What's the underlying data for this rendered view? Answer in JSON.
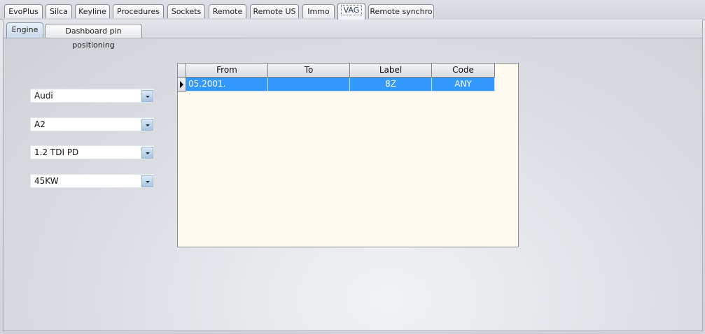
{
  "top_tabs": [
    {
      "label": "EvoPlus",
      "active": false
    },
    {
      "label": "Silca",
      "active": false
    },
    {
      "label": "Keyline",
      "active": false
    },
    {
      "label": "Procedures",
      "active": false
    },
    {
      "label": "Sockets",
      "active": false
    },
    {
      "label": "Remote",
      "active": false
    },
    {
      "label": "Remote US",
      "active": false
    },
    {
      "label": "Immo",
      "active": false
    },
    {
      "label": "VAG",
      "active": true
    },
    {
      "label": "Remote synchro",
      "active": false
    }
  ],
  "sub_tabs": [
    {
      "label": "Engine",
      "active": true
    },
    {
      "label": "Dashboard pin positioning",
      "active": false
    }
  ],
  "dropdowns": {
    "make": "Audi",
    "model": "A2",
    "engine": "1.2 TDI PD",
    "power": "45KW"
  },
  "grid": {
    "columns": [
      "From",
      "To",
      "Label",
      "Code"
    ],
    "rows": [
      {
        "from": "05.2001.",
        "to": "",
        "label": "8Z",
        "code": "ANY",
        "selected": true
      }
    ]
  },
  "colors": {
    "selection": "#3399ff",
    "grid_background": "#fefaf0"
  }
}
